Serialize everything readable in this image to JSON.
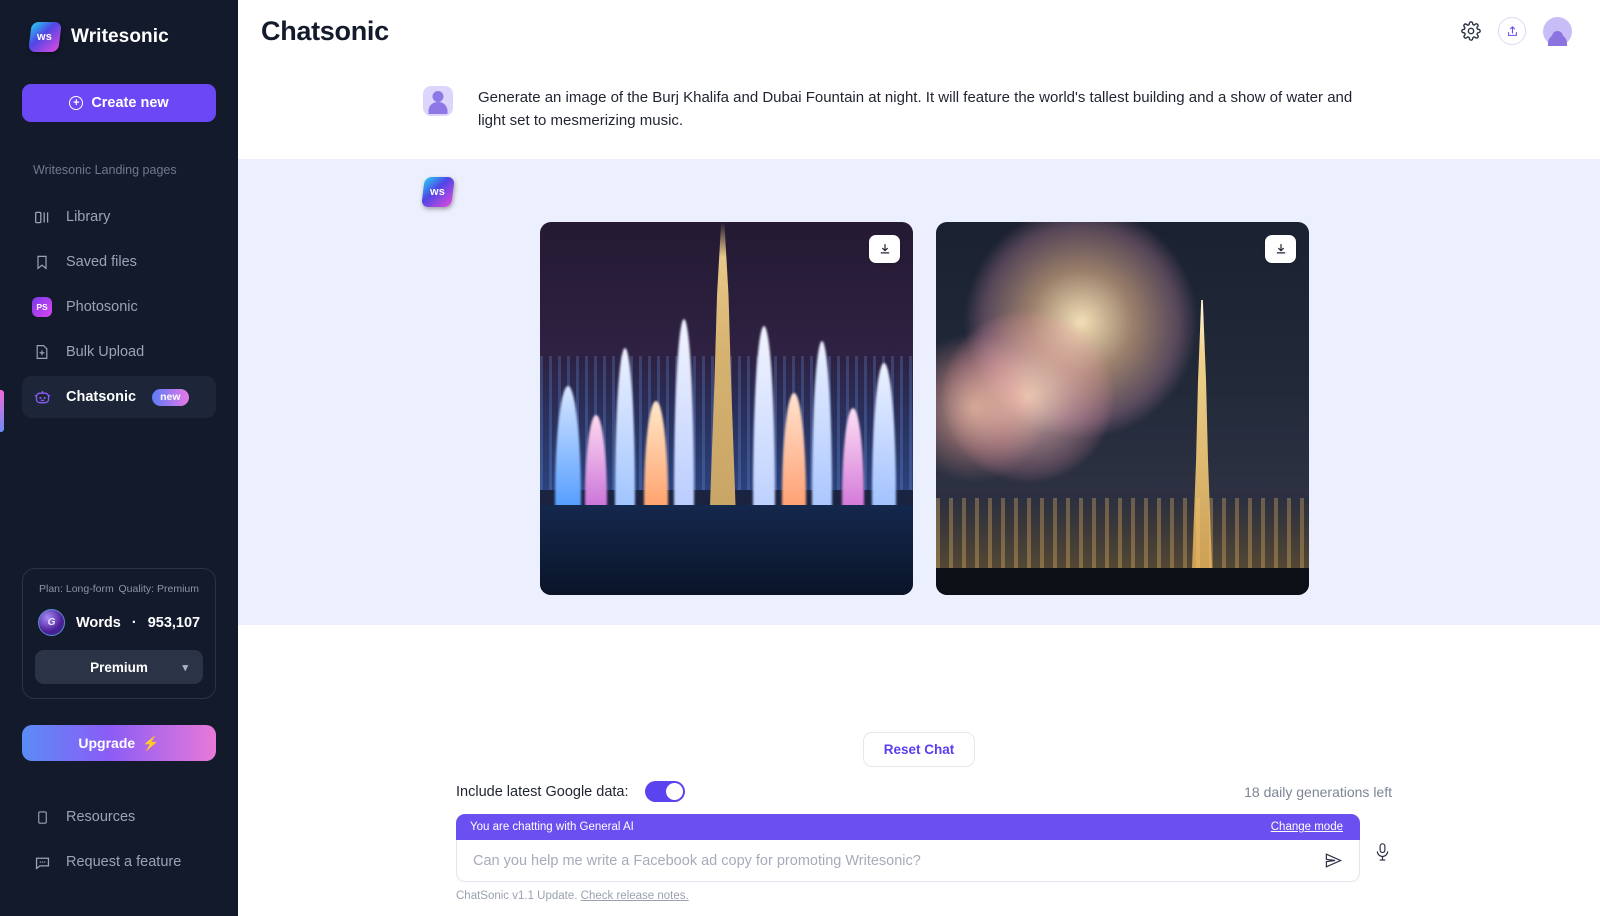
{
  "sidebar": {
    "brand": {
      "name": "Writesonic",
      "logo_text": "ws"
    },
    "create_new": {
      "label": "Create new",
      "icon": "plus-circle-icon"
    },
    "section_label": "Writesonic Landing pages",
    "items": [
      {
        "label": "Library",
        "icon": "columns-icon",
        "active": false
      },
      {
        "label": "Saved files",
        "icon": "bookmark-icon",
        "active": false
      },
      {
        "label": "Photosonic",
        "icon": "photosonic-logo-icon",
        "logo_text": "PS",
        "active": false
      },
      {
        "label": "Bulk Upload",
        "icon": "file-plus-icon",
        "active": false
      },
      {
        "label": "Chatsonic",
        "icon": "robot-icon",
        "badge": "new",
        "active": true
      }
    ],
    "plan_card": {
      "plan_label": "Plan: Long-form",
      "quality_label": "Quality: Premium",
      "words_label": "Words",
      "words_separator": "·",
      "words_count": "953,107",
      "orb_text": "G",
      "quality_select": "Premium",
      "chevron": "chevron-down-icon"
    },
    "upgrade": {
      "label": "Upgrade",
      "icon": "lightning-icon"
    },
    "bottom_items": [
      {
        "label": "Resources",
        "icon": "book-icon"
      },
      {
        "label": "Request a feature",
        "icon": "chat-bubble-icon"
      }
    ]
  },
  "header": {
    "title": "Chatsonic",
    "icons": [
      {
        "name": "gear-icon"
      },
      {
        "name": "share-icon"
      },
      {
        "name": "user-avatar"
      }
    ]
  },
  "conversation": {
    "user_message": {
      "avatar": "user-avatar-icon",
      "text": "Generate an image of the Burj Khalifa and Dubai Fountain at night. It will feature the world's tallest building and a show of water and light set to mesmerizing music."
    },
    "bot_message": {
      "avatar_text": "ws",
      "images": [
        {
          "alt": "Dubai Fountain with Burj Khalifa at night, colorful water jets",
          "download_label": "download-icon"
        },
        {
          "alt": "Fireworks over Burj Khalifa and Dubai skyline at night",
          "download_label": "download-icon"
        }
      ]
    }
  },
  "footer": {
    "reset_chat": "Reset Chat",
    "google_data_label": "Include latest Google data:",
    "google_data_on": true,
    "generations_left": "18 daily generations left",
    "composer": {
      "mode_text": "You are chatting with General AI",
      "change_mode": "Change mode",
      "placeholder": "Can you help me write a Facebook ad copy for promoting Writesonic?",
      "value": "",
      "send_icon": "send-icon",
      "mic_icon": "microphone-icon"
    },
    "release_prefix": "ChatSonic v1.1 Update. ",
    "release_link": "Check release notes."
  },
  "colors": {
    "sidebar_bg": "#131a2b",
    "accent_purple": "#6c47f5",
    "bot_bg": "#eceffd",
    "link_purple": "#5a3df0"
  }
}
